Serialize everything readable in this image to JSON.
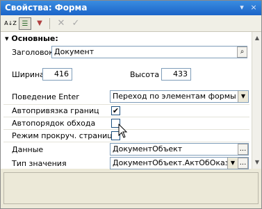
{
  "window": {
    "title": "Свойства: Форма"
  },
  "titlebar_buttons": {
    "pin": "▾",
    "close": "×"
  },
  "toolbar": {
    "sort_az": "A↓Z",
    "categories": "☰",
    "filter": "▼",
    "delete": "✕",
    "check": "✓"
  },
  "section": {
    "label": "Основные:"
  },
  "header_field": {
    "label": "Заголовок",
    "value": "Документ"
  },
  "size": {
    "width_label": "Ширина",
    "width_value": "416",
    "height_label": "Высота",
    "height_value": "433"
  },
  "enter_behavior": {
    "label": "Поведение Enter",
    "value": "Переход по элементам формы"
  },
  "auto_bind": {
    "label": "Автопривязка границ",
    "checked": true,
    "mark": "✔"
  },
  "auto_order": {
    "label": "Автопорядок обхода",
    "checked": false,
    "mark": ""
  },
  "scroll_mode": {
    "label": "Режим прокруч. страниц",
    "checked": false,
    "mark": ""
  },
  "data_field": {
    "label": "Данные",
    "value": "ДокументОбъект"
  },
  "value_type": {
    "label": "Тип значения",
    "value": "ДокументОбъект.АктОбОказанииУслуг"
  },
  "ellipsis": "...",
  "combo_arrow": "▼",
  "search_icon_glyph": "⌕",
  "scroll": {
    "up": "▲",
    "down": "▼"
  }
}
